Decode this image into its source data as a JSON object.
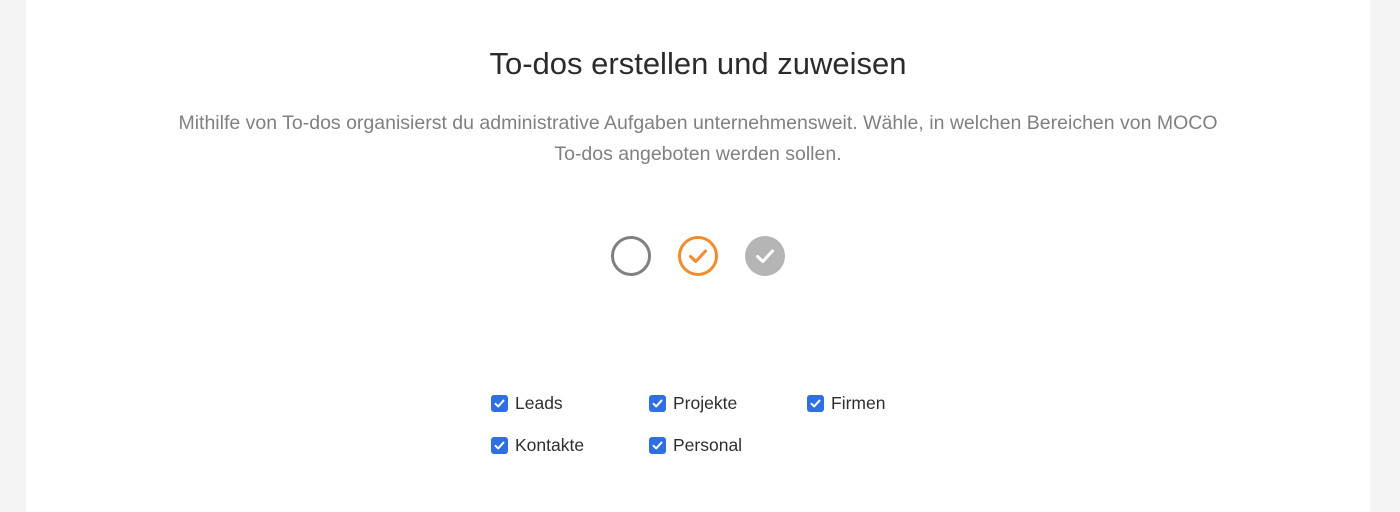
{
  "page": {
    "title": "To-dos erstellen und zuweisen",
    "description": "Mithilfe von To-dos organisierst du administrative Aufgaben unternehmensweit. Wähle, in welchen Bereichen von MOCO To-dos angeboten werden sollen."
  },
  "status_icons": [
    {
      "icon": "open-circle-icon",
      "color": "#808080"
    },
    {
      "icon": "orange-check-circle-icon",
      "color": "#f08c2c"
    },
    {
      "icon": "gray-filled-check-circle-icon",
      "color": "#b5b5b5"
    }
  ],
  "options": [
    {
      "label": "Leads",
      "checked": true
    },
    {
      "label": "Projekte",
      "checked": true
    },
    {
      "label": "Firmen",
      "checked": true
    },
    {
      "label": "Kontakte",
      "checked": true
    },
    {
      "label": "Personal",
      "checked": true
    }
  ],
  "colors": {
    "checkbox": "#2f6fe4",
    "background": "#f4f4f4",
    "card": "#ffffff"
  }
}
